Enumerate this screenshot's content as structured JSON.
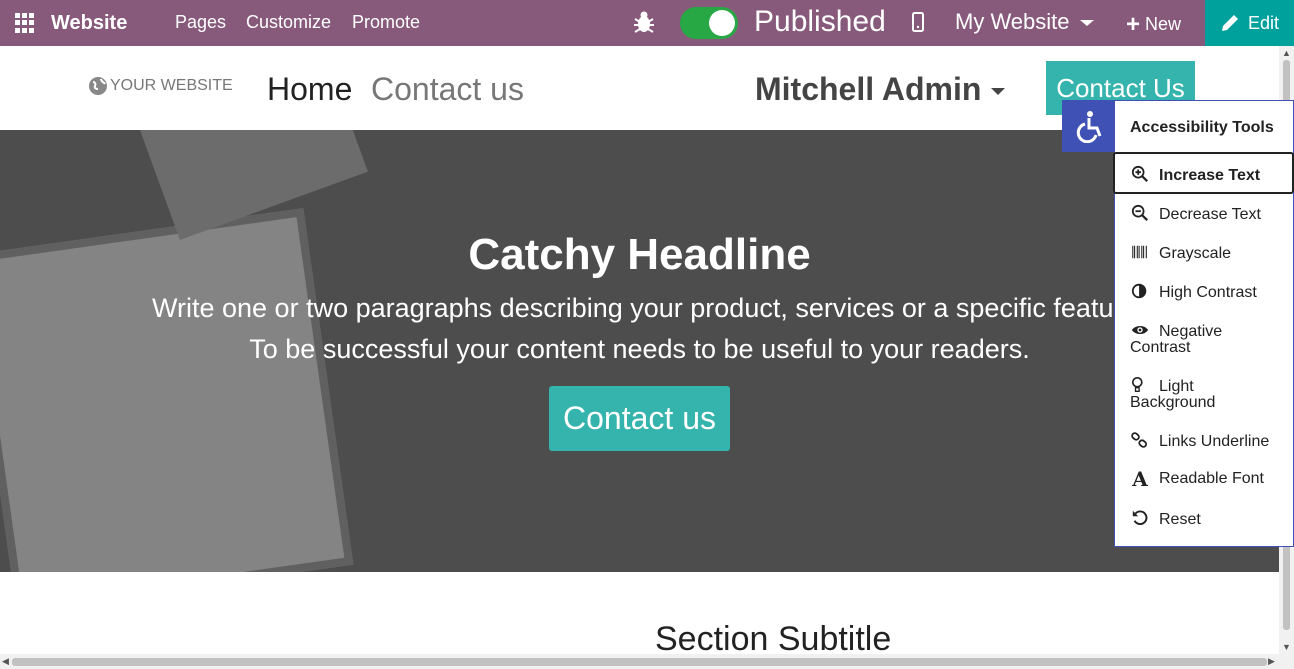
{
  "topbar": {
    "app_label": "Website",
    "menu": [
      "Pages",
      "Customize",
      "Promote"
    ],
    "published_label": "Published",
    "published_on": true,
    "website_label": "My Website",
    "new_label": "New",
    "edit_label": "Edit",
    "colors": {
      "bar": "#875a7b",
      "edit": "#00a09d",
      "toggle_on": "#28a745"
    }
  },
  "header": {
    "logo": "YOUR WEBSITE",
    "nav": [
      "Home",
      "Contact us"
    ],
    "user": "Mitchell Admin",
    "cta": "Contact Us",
    "cta_color": "#35b3ad"
  },
  "hero": {
    "title": "Catchy Headline",
    "line1": "Write one or two paragraphs describing your product, services or a specific feature.",
    "line2": "To be successful your content needs to be useful to your readers.",
    "button": "Contact us"
  },
  "section": {
    "subtitle": "Section Subtitle"
  },
  "accessibility": {
    "title": "Accessibility Tools",
    "items": [
      {
        "label": "Increase Text",
        "icon": "zoom-in-icon"
      },
      {
        "label": "Decrease Text",
        "icon": "zoom-out-icon"
      },
      {
        "label": "Grayscale",
        "icon": "barcode-icon"
      },
      {
        "label": "High Contrast",
        "icon": "half-circle-icon"
      },
      {
        "label1": "Negative",
        "label2": "Contrast",
        "icon": "eye-icon"
      },
      {
        "label1": "Light",
        "label2": "Background",
        "icon": "lightbulb-icon"
      },
      {
        "label": "Links Underline",
        "icon": "link-icon"
      },
      {
        "label": "Readable Font",
        "icon": "font-icon"
      },
      {
        "label": "Reset",
        "icon": "reset-icon"
      }
    ],
    "accent": "#3f51b5"
  }
}
